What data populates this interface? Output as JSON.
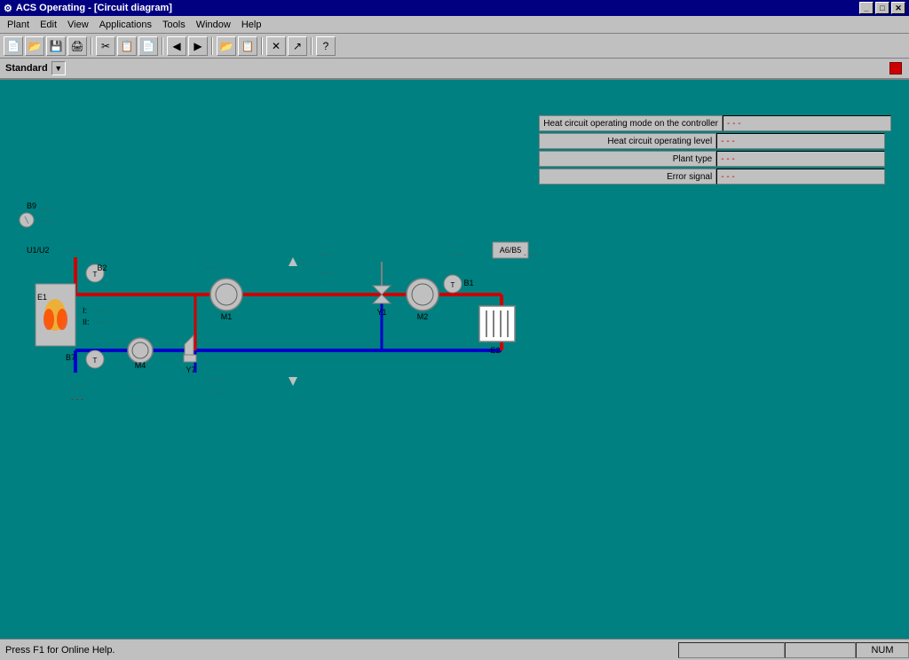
{
  "titleBar": {
    "icon": "⚙",
    "title": "ACS Operating - [Circuit diagram]",
    "minimizeLabel": "_",
    "maximizeLabel": "□",
    "closeLabel": "✕",
    "innerMinimize": "_",
    "innerMaximize": "□",
    "innerClose": "✕"
  },
  "menuBar": {
    "items": [
      "Plant",
      "Edit",
      "View",
      "Applications",
      "Tools",
      "Window",
      "Help"
    ]
  },
  "toolbar": {
    "buttons": [
      "📁",
      "💾",
      "🖨",
      "✂",
      "📋",
      "⬅",
      "➡",
      "📂",
      "📋",
      "✕",
      "↗",
      "?"
    ]
  },
  "standardBar": {
    "label": "Standard",
    "dropdownArrow": "▼"
  },
  "infoPanel": {
    "rows": [
      {
        "label": "Heat circuit operating mode on the controller",
        "value": "- - -"
      },
      {
        "label": "Heat circuit operating level",
        "value": "- - -"
      },
      {
        "label": "Plant type",
        "value": "- - -"
      },
      {
        "label": "Error signal",
        "value": "- - -"
      }
    ]
  },
  "diagram": {
    "components": {
      "B9": "B9",
      "B2": "B2",
      "U1U2": "U1/U2",
      "E1": "E1",
      "B7": "B7",
      "M1": "M1",
      "M2": "M2",
      "M4": "M4",
      "Y1": "Y1",
      "Y7": "Y7",
      "B1": "B1",
      "E2": "E2",
      "A6B5": "A6/B5"
    },
    "labels": {
      "I": "I:",
      "II": "II:",
      "dashes": "- - -"
    }
  },
  "statusBar": {
    "helpText": "Press F1 for Online Help.",
    "sections": [
      "",
      "",
      "NUM"
    ]
  },
  "colors": {
    "background": "#008080",
    "pipeRed": "#cc0000",
    "pipeBlue": "#0000cc",
    "componentGray": "#c0c0c0",
    "accent": "#cc0000"
  }
}
